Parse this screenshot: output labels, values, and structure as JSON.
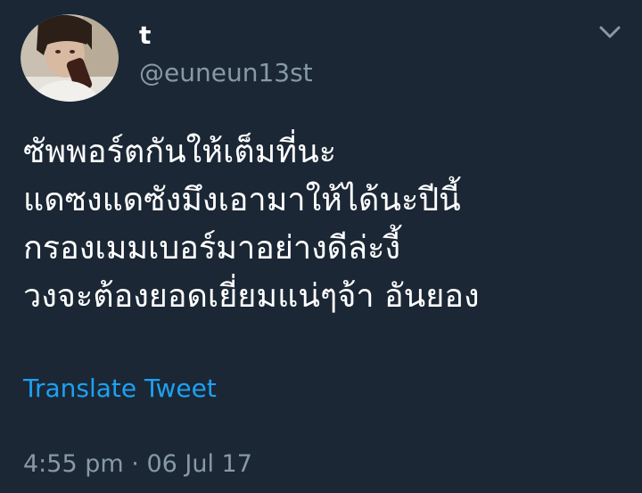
{
  "user": {
    "name": "t",
    "handle": "@euneun13st"
  },
  "tweet": {
    "lines": [
      "ซัพพอร์ตกันให้เต็มที่นะ",
      "แดซงแดซังมึงเอามาให้ได้นะปีนี้",
      "กรองเมมเบอร์มาอย่างดีล่ะงี้",
      "วงจะต้องยอดเยี่ยมแน่ๆจ้า อันยอง"
    ],
    "translate_label": "Translate Tweet",
    "time": "4:55 pm",
    "separator": "·",
    "date": "06 Jul 17"
  },
  "icons": {
    "menu": "chevron-down-icon",
    "avatar": "profile-photo"
  },
  "colors": {
    "background": "#1b2735",
    "text": "#ffffff",
    "secondary": "#8899a6",
    "link": "#1da1f2"
  }
}
